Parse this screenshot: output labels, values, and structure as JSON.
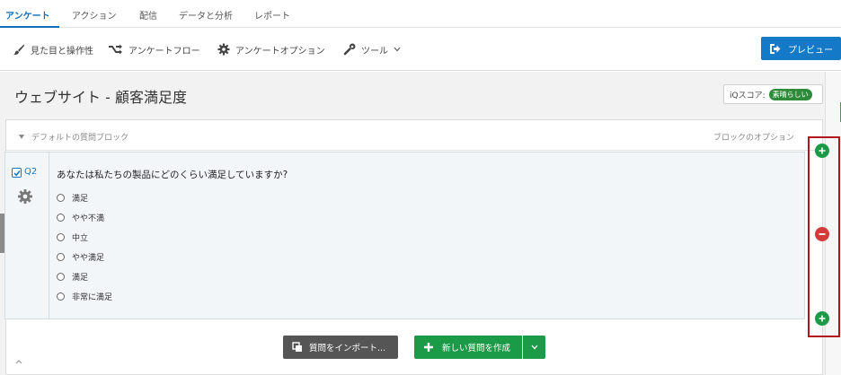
{
  "topnav": {
    "tabs": [
      {
        "label": "アンケート",
        "active": true
      },
      {
        "label": "アクション",
        "active": false
      },
      {
        "label": "配信",
        "active": false
      },
      {
        "label": "データと分析",
        "active": false
      },
      {
        "label": "レポート",
        "active": false
      }
    ]
  },
  "toolbar": {
    "look_feel": "見た目と操作性",
    "survey_flow": "アンケートフロー",
    "survey_options": "アンケートオプション",
    "tools": "ツール",
    "preview": "プレビュー"
  },
  "survey": {
    "title": "ウェブサイト - 顧客満足度",
    "iq_label": "iQスコア:",
    "iq_value": "素晴らしい"
  },
  "block": {
    "name": "デフォルトの質問ブロック",
    "options_label": "ブロックのオプション"
  },
  "question": {
    "id": "Q2",
    "text": "あなたは私たちの製品にどのくらい満足していますか?",
    "choices": [
      "満足",
      "やや不満",
      "中立",
      "やや満足",
      "満足",
      "非常に満足"
    ]
  },
  "actions": {
    "import_label": "質問をインポート...",
    "new_question_label": "新しい質問を作成"
  },
  "colors": {
    "accent": "#1479c6",
    "green": "#1b9a47",
    "red": "#d33b3b",
    "annotation": "#b0141d"
  },
  "icons": {
    "look_feel": "paintbrush-icon",
    "survey_flow": "flow-icon",
    "survey_options": "gear-icon",
    "tools": "wrench-icon",
    "preview": "preview-icon",
    "import": "copy-icon",
    "new_question": "plus-icon"
  }
}
